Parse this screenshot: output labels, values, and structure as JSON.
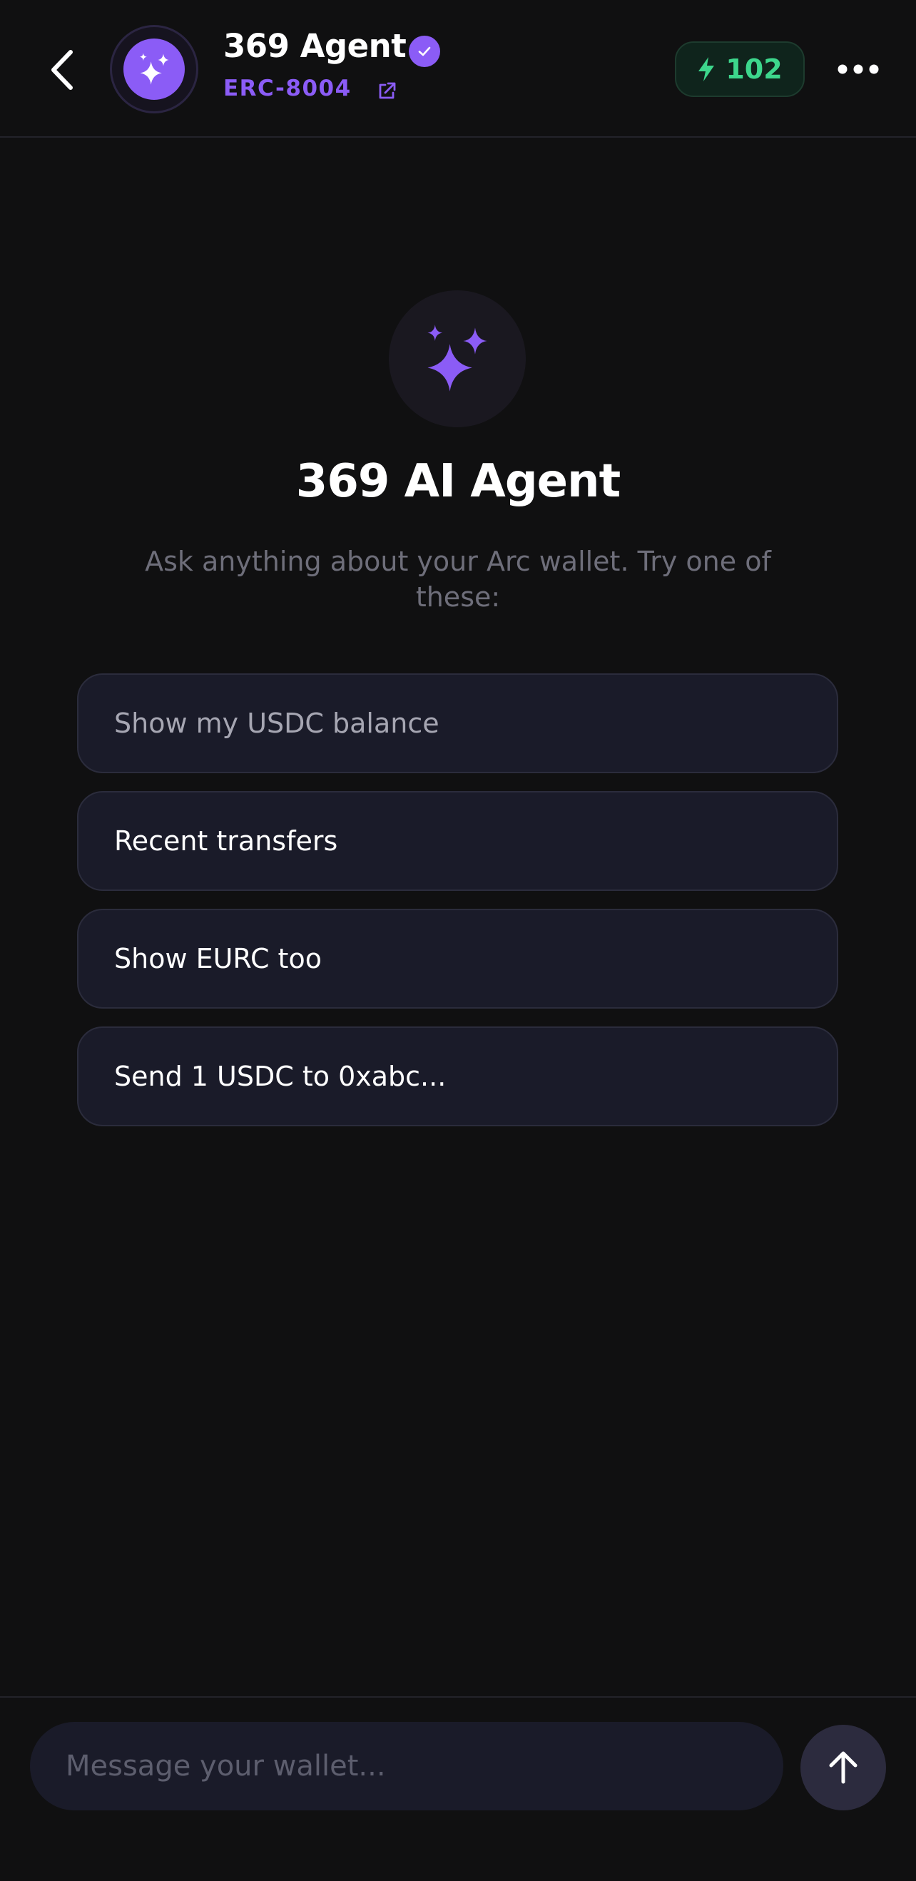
{
  "header": {
    "back_icon": "chevron-left-icon",
    "avatar_icon": "sparkles-icon",
    "agent_name": "369 Agent",
    "verified_icon": "check-badge-icon",
    "standard_label": "ERC-8004",
    "external_link_icon": "external-link-icon",
    "energy_icon": "lightning-bolt-icon",
    "energy_count": "102",
    "more_icon": "more-horizontal-icon"
  },
  "hero": {
    "icon": "sparkles-icon",
    "title": "369 AI Agent",
    "subtitle": "Ask anything about your Arc wallet. Try one of these:"
  },
  "suggestions": [
    {
      "label": "Show my USDC balance"
    },
    {
      "label": "Recent transfers"
    },
    {
      "label": "Show EURC too"
    },
    {
      "label": "Send 1 USDC to 0xabc..."
    }
  ],
  "composer": {
    "placeholder": "Message your wallet...",
    "value": "",
    "send_icon": "arrow-up-icon"
  },
  "colors": {
    "background": "#101011",
    "accent_purple": "#8b5cf6",
    "energy_green": "#3dd68c",
    "card": "#1a1b29"
  }
}
